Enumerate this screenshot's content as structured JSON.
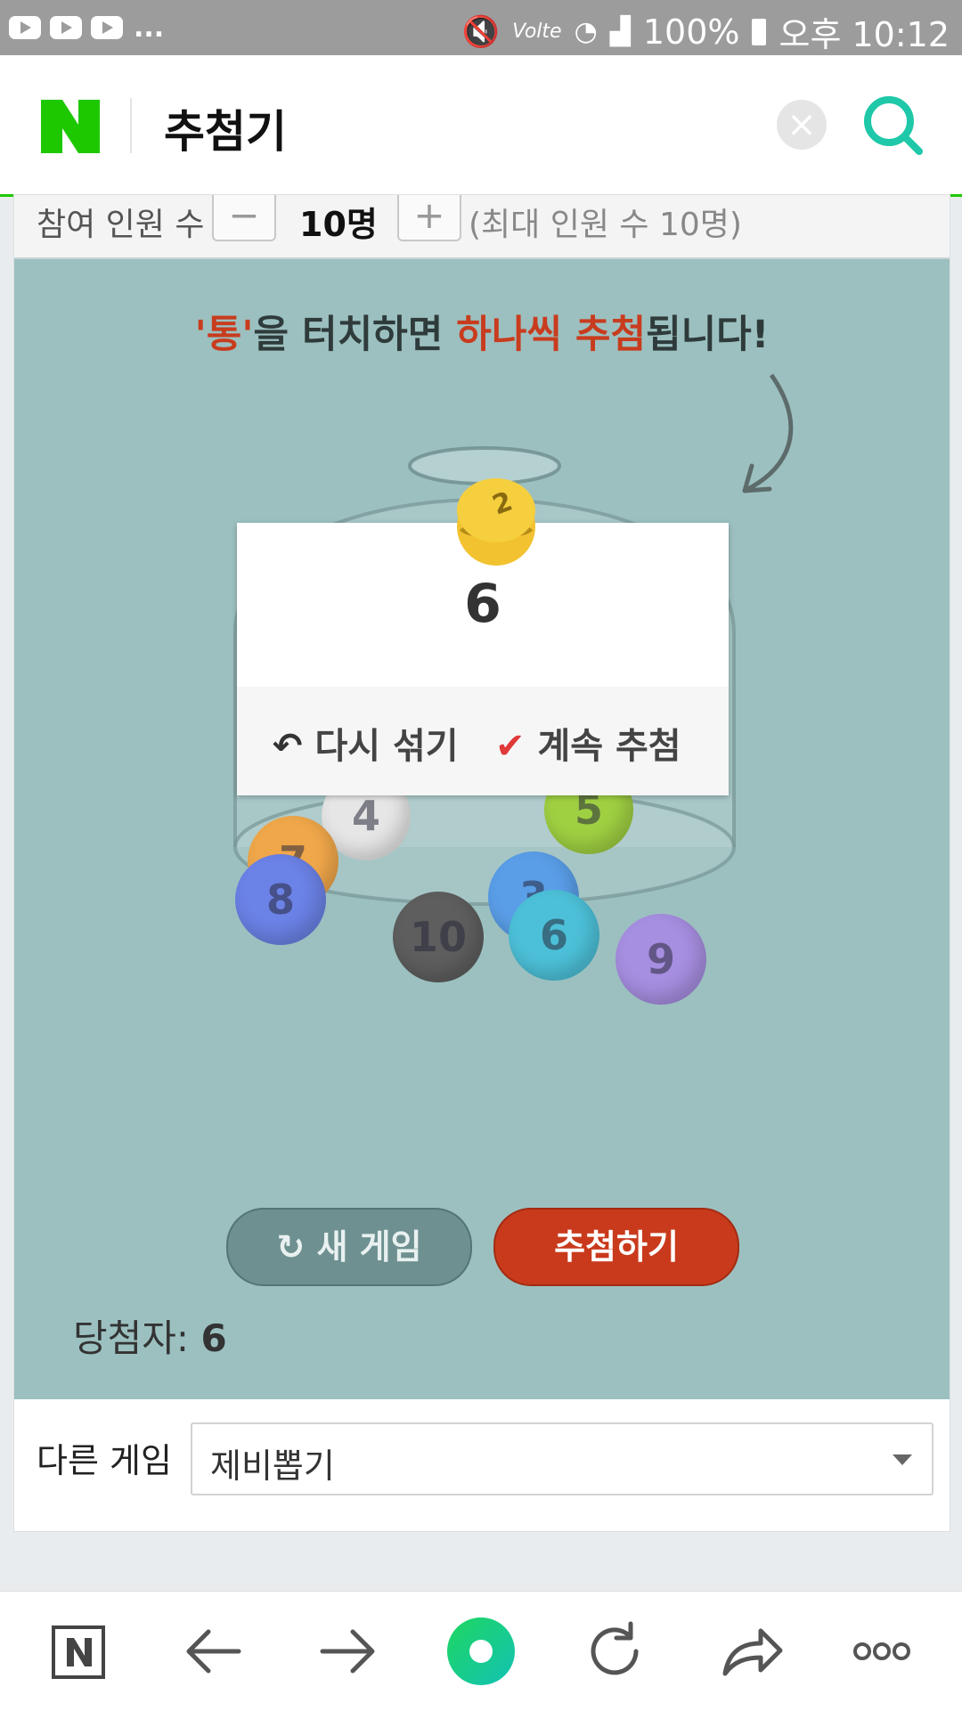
{
  "status_bar": {
    "overflow": "...",
    "network": "Volte",
    "battery": "100%",
    "time": "오후 10:12"
  },
  "header": {
    "title": "추첨기"
  },
  "participants": {
    "label": "참여 인원 수",
    "minus": "−",
    "value": "10명",
    "plus": "+",
    "max_note": "(최대 인원 수 10명)"
  },
  "game": {
    "instruction_parts": [
      "'통'",
      "을 터치하면 ",
      "하나씩 추첨",
      "됩니다!"
    ],
    "balls": [
      {
        "label": "4",
        "color": "#e6e6e6"
      },
      {
        "label": "5",
        "color": "#9fd042"
      },
      {
        "label": "7",
        "color": "#f0a74a"
      },
      {
        "label": "8",
        "color": "#6b82e6"
      },
      {
        "label": "3",
        "color": "#5a9ee8"
      },
      {
        "label": "10",
        "color": "#5e5e5e"
      },
      {
        "label": "6",
        "color": "#4cc0d8"
      },
      {
        "label": "9",
        "color": "#a68ee0"
      }
    ],
    "popup": {
      "ball_label": "2",
      "number": "6",
      "reshuffle": "다시 섞기",
      "continue": "계속 추첨"
    },
    "new_game": "새 게임",
    "draw": "추첨하기",
    "winner_label": "당첨자:",
    "winner_value": "6"
  },
  "other_game": {
    "label": "다른 게임",
    "selected": "제비뽑기"
  },
  "colors": {
    "naver_green": "#1ec800",
    "draw_red": "#c93a1c",
    "game_bg": "#9cc0c0"
  }
}
